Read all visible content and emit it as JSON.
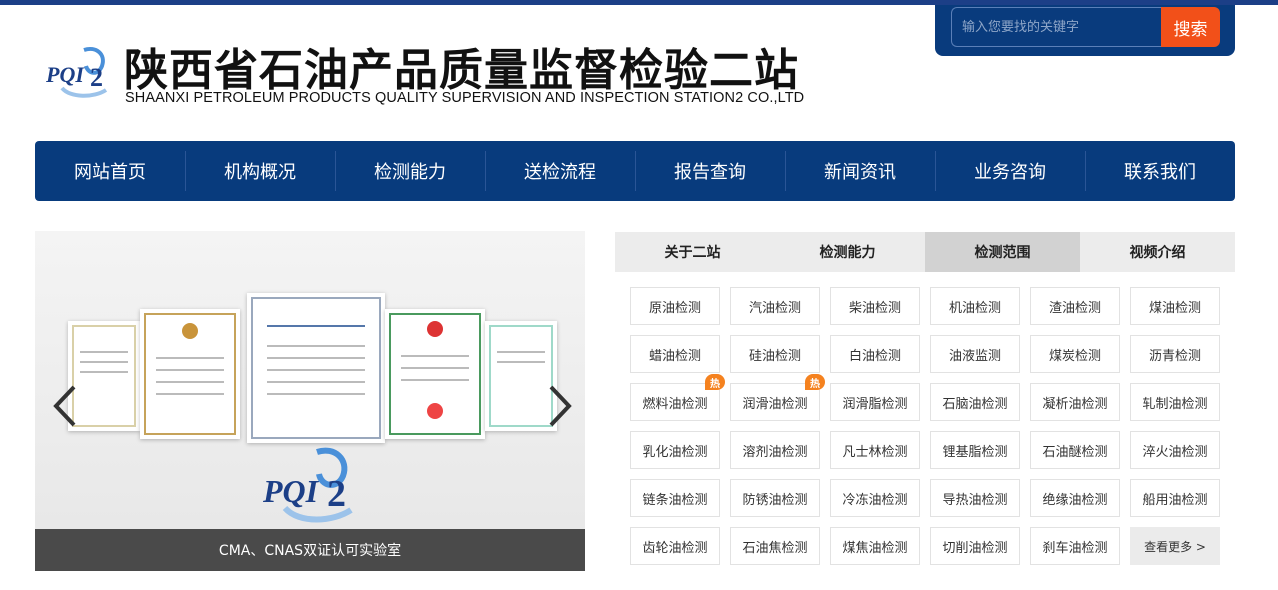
{
  "header": {
    "logo_text": "PQI2",
    "title": "陕西省石油产品质量监督检验二站",
    "subtitle": "SHAANXI PETROLEUM PRODUCTS QUALITY SUPERVISION AND INSPECTION STATION2 CO.,LTD"
  },
  "search": {
    "placeholder": "输入您要找的关键字",
    "button_label": "搜索"
  },
  "nav": {
    "items": [
      "网站首页",
      "机构概况",
      "检测能力",
      "送检流程",
      "报告查询",
      "新闻资讯",
      "业务咨询",
      "联系我们"
    ]
  },
  "slider": {
    "caption": "CMA、CNAS双证认可实验室",
    "logo_text": "PQI2"
  },
  "tabs": {
    "items": [
      "关于二站",
      "检测能力",
      "检测范围",
      "视频介绍"
    ],
    "active": "检测范围"
  },
  "services": {
    "items": [
      "原油检测",
      "汽油检测",
      "柴油检测",
      "机油检测",
      "渣油检测",
      "煤油检测",
      "蜡油检测",
      "硅油检测",
      "白油检测",
      "油液监测",
      "煤炭检测",
      "沥青检测",
      "燃料油检测",
      "润滑油检测",
      "润滑脂检测",
      "石脑油检测",
      "凝析油检测",
      "轧制油检测",
      "乳化油检测",
      "溶剂油检测",
      "凡士林检测",
      "锂基脂检测",
      "石油醚检测",
      "淬火油检测",
      "链条油检测",
      "防锈油检测",
      "冷冻油检测",
      "导热油检测",
      "绝缘油检测",
      "船用油检测",
      "齿轮油检测",
      "石油焦检测",
      "煤焦油检测",
      "切削油检测",
      "刹车油检测"
    ],
    "hot_badge": "热",
    "hot_items": [
      "燃料油检测",
      "润滑油检测"
    ],
    "more_label": "查看更多 >"
  },
  "colors": {
    "brand_blue": "#083b7d",
    "search_orange": "#f25019",
    "hot_orange": "#f5821f"
  }
}
